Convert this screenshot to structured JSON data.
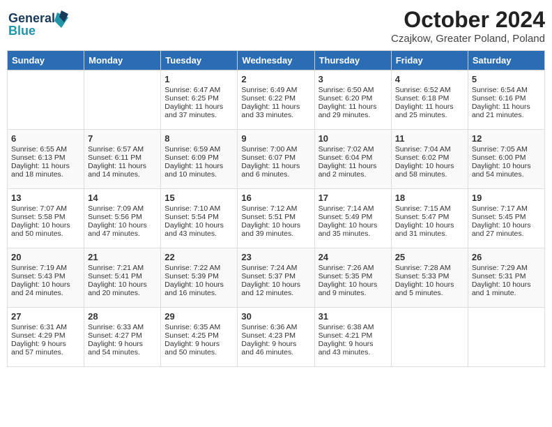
{
  "header": {
    "logo_line1": "General",
    "logo_line2": "Blue",
    "month_title": "October 2024",
    "location": "Czajkow, Greater Poland, Poland"
  },
  "days_of_week": [
    "Sunday",
    "Monday",
    "Tuesday",
    "Wednesday",
    "Thursday",
    "Friday",
    "Saturday"
  ],
  "weeks": [
    [
      null,
      null,
      {
        "day": 1,
        "sunrise": "6:47 AM",
        "sunset": "6:25 PM",
        "daylight": "11 hours and 37 minutes."
      },
      {
        "day": 2,
        "sunrise": "6:49 AM",
        "sunset": "6:22 PM",
        "daylight": "11 hours and 33 minutes."
      },
      {
        "day": 3,
        "sunrise": "6:50 AM",
        "sunset": "6:20 PM",
        "daylight": "11 hours and 29 minutes."
      },
      {
        "day": 4,
        "sunrise": "6:52 AM",
        "sunset": "6:18 PM",
        "daylight": "11 hours and 25 minutes."
      },
      {
        "day": 5,
        "sunrise": "6:54 AM",
        "sunset": "6:16 PM",
        "daylight": "11 hours and 21 minutes."
      }
    ],
    [
      {
        "day": 6,
        "sunrise": "6:55 AM",
        "sunset": "6:13 PM",
        "daylight": "11 hours and 18 minutes."
      },
      {
        "day": 7,
        "sunrise": "6:57 AM",
        "sunset": "6:11 PM",
        "daylight": "11 hours and 14 minutes."
      },
      {
        "day": 8,
        "sunrise": "6:59 AM",
        "sunset": "6:09 PM",
        "daylight": "11 hours and 10 minutes."
      },
      {
        "day": 9,
        "sunrise": "7:00 AM",
        "sunset": "6:07 PM",
        "daylight": "11 hours and 6 minutes."
      },
      {
        "day": 10,
        "sunrise": "7:02 AM",
        "sunset": "6:04 PM",
        "daylight": "11 hours and 2 minutes."
      },
      {
        "day": 11,
        "sunrise": "7:04 AM",
        "sunset": "6:02 PM",
        "daylight": "10 hours and 58 minutes."
      },
      {
        "day": 12,
        "sunrise": "7:05 AM",
        "sunset": "6:00 PM",
        "daylight": "10 hours and 54 minutes."
      }
    ],
    [
      {
        "day": 13,
        "sunrise": "7:07 AM",
        "sunset": "5:58 PM",
        "daylight": "10 hours and 50 minutes."
      },
      {
        "day": 14,
        "sunrise": "7:09 AM",
        "sunset": "5:56 PM",
        "daylight": "10 hours and 47 minutes."
      },
      {
        "day": 15,
        "sunrise": "7:10 AM",
        "sunset": "5:54 PM",
        "daylight": "10 hours and 43 minutes."
      },
      {
        "day": 16,
        "sunrise": "7:12 AM",
        "sunset": "5:51 PM",
        "daylight": "10 hours and 39 minutes."
      },
      {
        "day": 17,
        "sunrise": "7:14 AM",
        "sunset": "5:49 PM",
        "daylight": "10 hours and 35 minutes."
      },
      {
        "day": 18,
        "sunrise": "7:15 AM",
        "sunset": "5:47 PM",
        "daylight": "10 hours and 31 minutes."
      },
      {
        "day": 19,
        "sunrise": "7:17 AM",
        "sunset": "5:45 PM",
        "daylight": "10 hours and 27 minutes."
      }
    ],
    [
      {
        "day": 20,
        "sunrise": "7:19 AM",
        "sunset": "5:43 PM",
        "daylight": "10 hours and 24 minutes."
      },
      {
        "day": 21,
        "sunrise": "7:21 AM",
        "sunset": "5:41 PM",
        "daylight": "10 hours and 20 minutes."
      },
      {
        "day": 22,
        "sunrise": "7:22 AM",
        "sunset": "5:39 PM",
        "daylight": "10 hours and 16 minutes."
      },
      {
        "day": 23,
        "sunrise": "7:24 AM",
        "sunset": "5:37 PM",
        "daylight": "10 hours and 12 minutes."
      },
      {
        "day": 24,
        "sunrise": "7:26 AM",
        "sunset": "5:35 PM",
        "daylight": "10 hours and 9 minutes."
      },
      {
        "day": 25,
        "sunrise": "7:28 AM",
        "sunset": "5:33 PM",
        "daylight": "10 hours and 5 minutes."
      },
      {
        "day": 26,
        "sunrise": "7:29 AM",
        "sunset": "5:31 PM",
        "daylight": "10 hours and 1 minute."
      }
    ],
    [
      {
        "day": 27,
        "sunrise": "6:31 AM",
        "sunset": "4:29 PM",
        "daylight": "9 hours and 57 minutes."
      },
      {
        "day": 28,
        "sunrise": "6:33 AM",
        "sunset": "4:27 PM",
        "daylight": "9 hours and 54 minutes."
      },
      {
        "day": 29,
        "sunrise": "6:35 AM",
        "sunset": "4:25 PM",
        "daylight": "9 hours and 50 minutes."
      },
      {
        "day": 30,
        "sunrise": "6:36 AM",
        "sunset": "4:23 PM",
        "daylight": "9 hours and 46 minutes."
      },
      {
        "day": 31,
        "sunrise": "6:38 AM",
        "sunset": "4:21 PM",
        "daylight": "9 hours and 43 minutes."
      },
      null,
      null
    ]
  ]
}
